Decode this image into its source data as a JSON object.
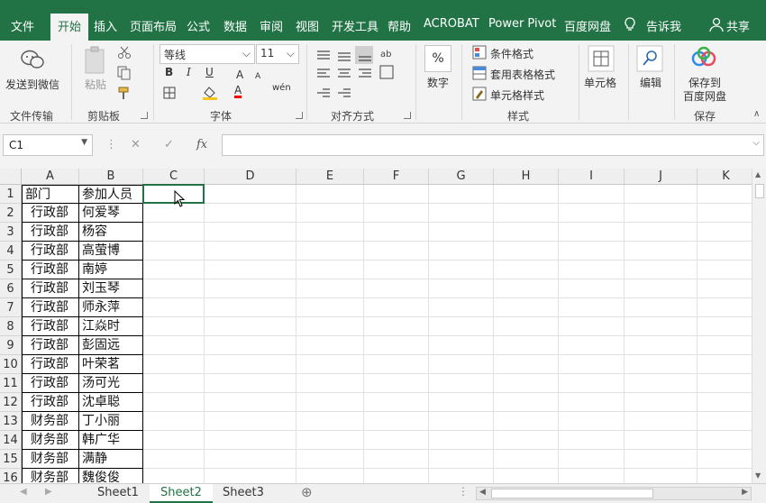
{
  "ribbon_tabs": [
    "文件",
    "开始",
    "插入",
    "页面布局",
    "公式",
    "数据",
    "审阅",
    "视图",
    "开发工具",
    "帮助",
    "ACROBAT",
    "Power Pivot",
    "百度网盘"
  ],
  "tell_me": "告诉我",
  "share": "共享",
  "ribbon": {
    "wechat_label": "发送到微信",
    "paste_label": "粘贴",
    "font_name": "等线",
    "font_size": "11",
    "bold": "B",
    "italic": "I",
    "underline": "U",
    "font_color_letter": "A",
    "wen_label": "wén",
    "number_label": "数字",
    "percent_glyph": "%",
    "cond_format": "条件格式",
    "table_format": "套用表格格式",
    "cell_style": "单元格样式",
    "cells_label": "单元格",
    "edit_label": "编辑",
    "save_line1": "保存到",
    "save_line2": "百度网盘",
    "groups": {
      "file_transfer": "文件传输",
      "clipboard": "剪贴板",
      "font": "字体",
      "alignment": "对齐方式",
      "styles": "样式",
      "save": "保存"
    }
  },
  "formula_bar": {
    "name_box": "C1",
    "cancel_icon": "✕",
    "enter_icon": "✓",
    "fx": "fx",
    "value": ""
  },
  "columns": [
    "A",
    "B",
    "C",
    "D",
    "E",
    "F",
    "G",
    "H",
    "I",
    "J",
    "K"
  ],
  "rows": [
    "1",
    "2",
    "3",
    "4",
    "5",
    "6",
    "7",
    "8",
    "9",
    "10",
    "11",
    "12",
    "13",
    "14",
    "15",
    "16"
  ],
  "cells": [
    [
      "部门",
      "参加人员"
    ],
    [
      "行政部",
      "何爱琴"
    ],
    [
      "行政部",
      "杨容"
    ],
    [
      "行政部",
      "高萤博"
    ],
    [
      "行政部",
      "南婷"
    ],
    [
      "行政部",
      "刘玉琴"
    ],
    [
      "行政部",
      "师永萍"
    ],
    [
      "行政部",
      "江焱时"
    ],
    [
      "行政部",
      "彭固远"
    ],
    [
      "行政部",
      "叶荣茗"
    ],
    [
      "行政部",
      "汤可光"
    ],
    [
      "行政部",
      "沈卓聪"
    ],
    [
      "财务部",
      "丁小丽"
    ],
    [
      "财务部",
      "韩广华"
    ],
    [
      "财务部",
      "满静"
    ],
    [
      "财务部",
      "魏俊俊"
    ]
  ],
  "sheets": [
    "Sheet1",
    "Sheet2",
    "Sheet3"
  ],
  "active_sheet": "Sheet2",
  "colors": {
    "excel_green": "#217346",
    "ribbon_bg": "#f3f3f3"
  }
}
